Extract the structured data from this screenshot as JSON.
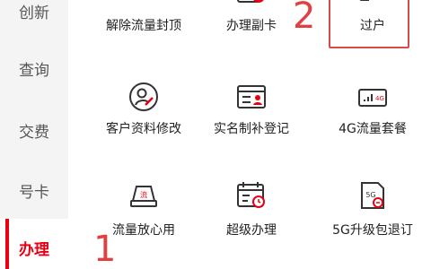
{
  "sidebar": {
    "items": [
      {
        "label": "创新"
      },
      {
        "label": "查询"
      },
      {
        "label": "交费"
      },
      {
        "label": "号卡"
      },
      {
        "label": "办理"
      }
    ],
    "active_index": 4
  },
  "grid": {
    "row0": [
      {
        "label": "解除流量封顶",
        "icon": "unlock-data-icon"
      },
      {
        "label": "办理副卡",
        "icon": "secondary-card-icon"
      },
      {
        "label": "过户",
        "icon": "transfer-ownership-icon"
      }
    ],
    "row1": [
      {
        "label": "客户资料修改",
        "icon": "edit-profile-icon"
      },
      {
        "label": "实名制补登记",
        "icon": "realname-register-icon"
      },
      {
        "label": "4G流量套餐",
        "icon": "4g-data-plan-icon"
      }
    ],
    "row2": [
      {
        "label": "流量放心用",
        "icon": "worry-free-data-icon"
      },
      {
        "label": "超级办理",
        "icon": "super-handle-icon"
      },
      {
        "label": "5G升级包退订",
        "icon": "5g-upgrade-unsubscribe-icon"
      }
    ]
  },
  "annotations": {
    "step1": "1",
    "step2": "2"
  },
  "colors": {
    "accent": "#e60012",
    "annotation": "#e04040",
    "icon_stroke": "#333333",
    "icon_accent": "#e60012"
  },
  "icon_text": {
    "badge_fu": "副",
    "badge_4g": "4G",
    "badge_5g": "5G",
    "badge_liu": "流"
  }
}
